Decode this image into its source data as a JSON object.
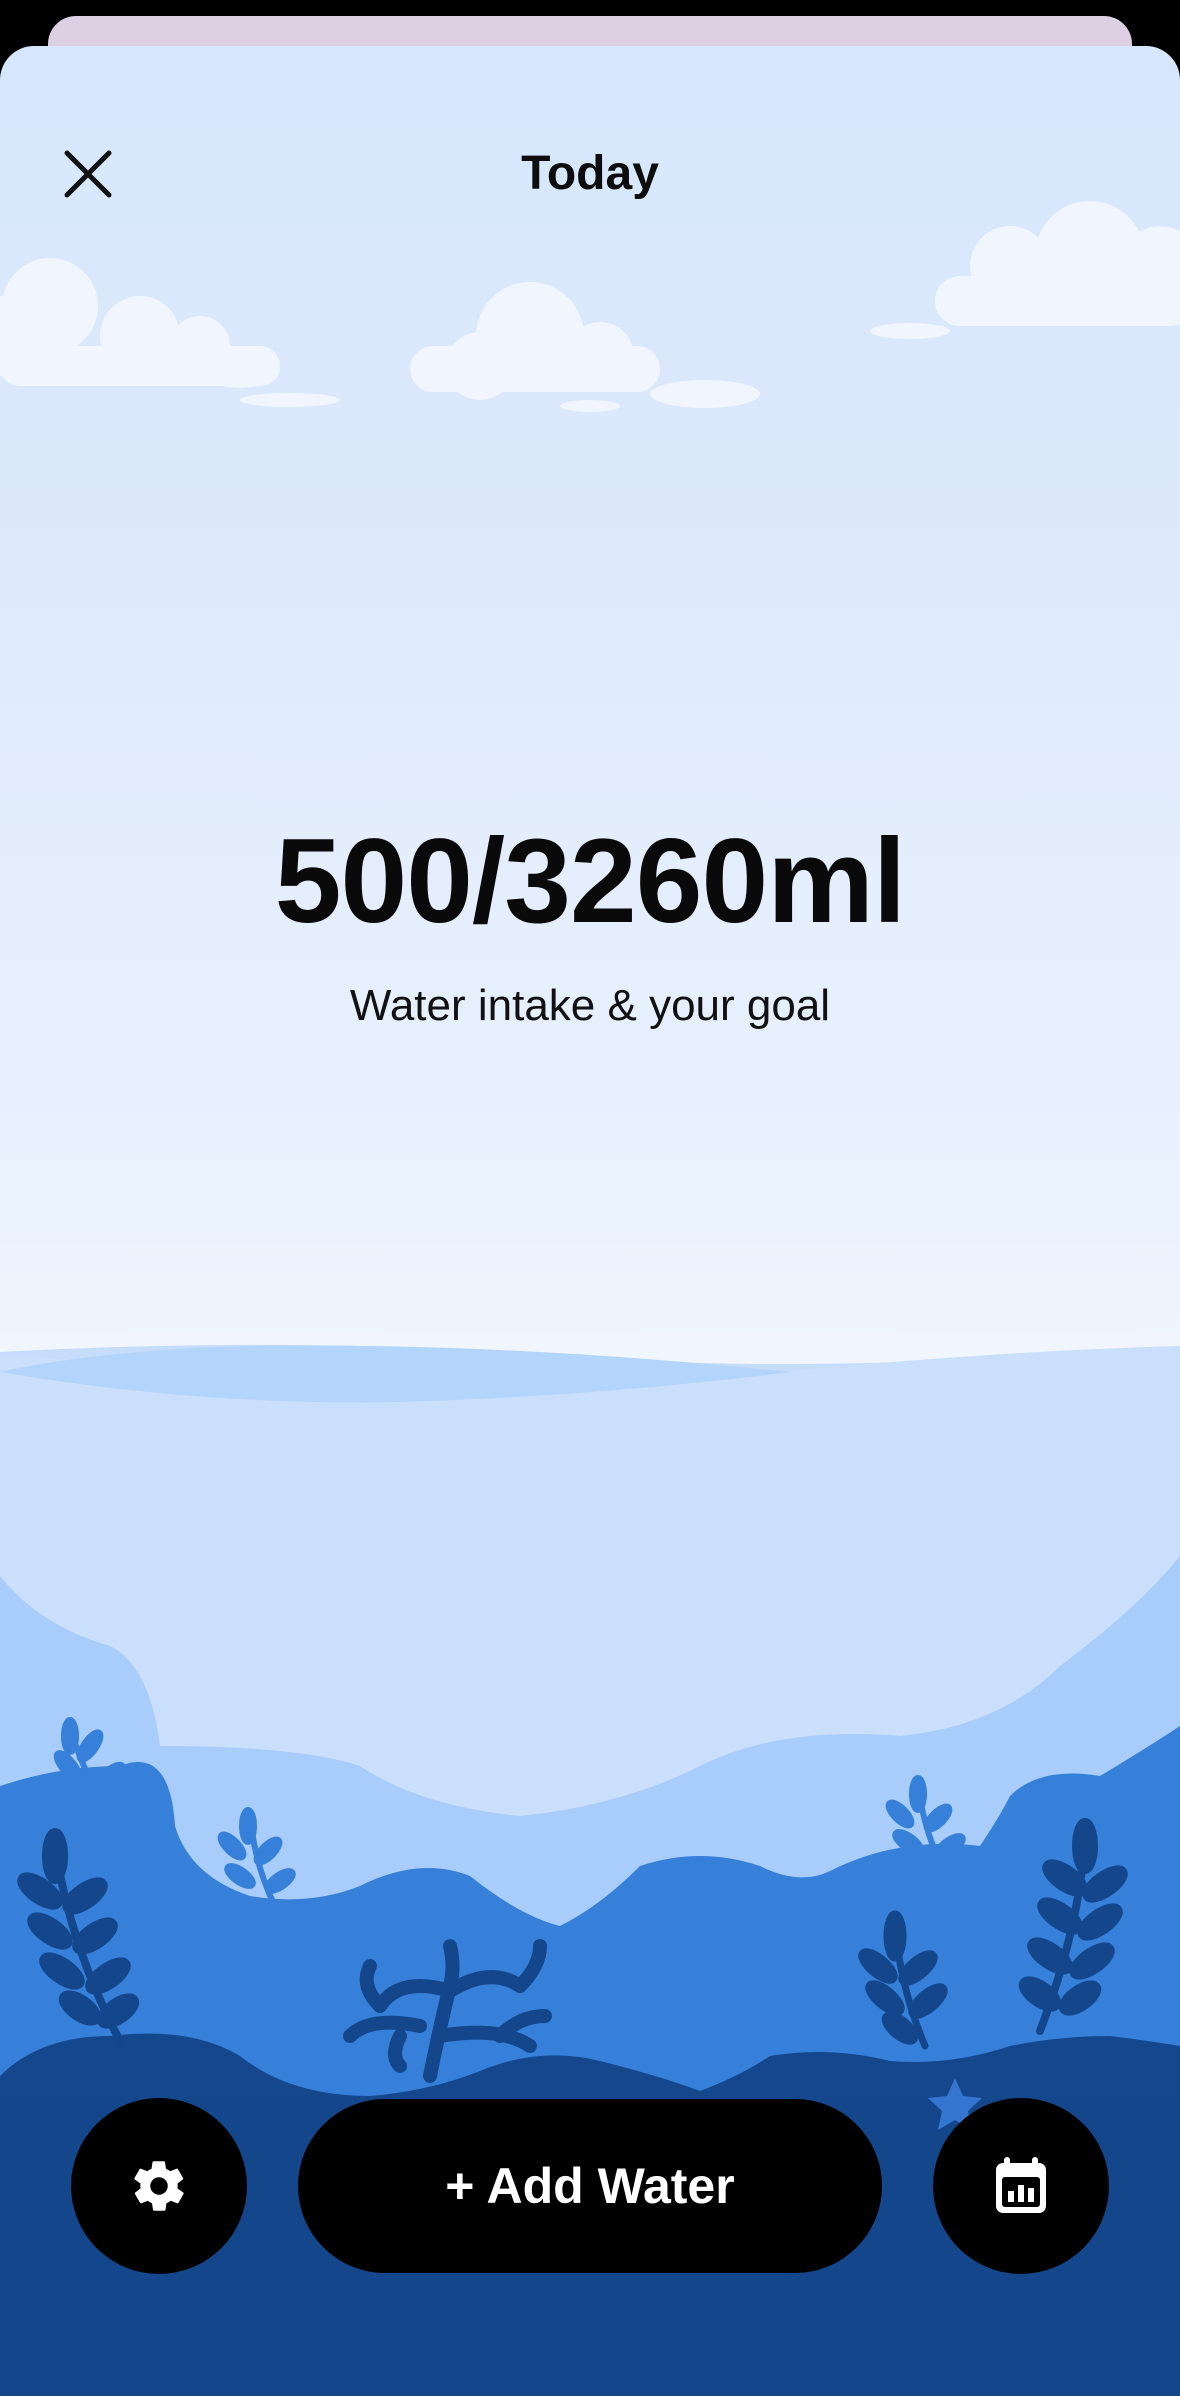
{
  "header": {
    "title": "Today",
    "close_icon": "close-icon"
  },
  "intake": {
    "value_text": "500/3260ml",
    "current_ml": 500,
    "goal_ml": 3260,
    "caption": "Water intake & your goal"
  },
  "actions": {
    "settings_icon": "gear-icon",
    "add_label": "+ Add Water",
    "stats_icon": "calendar-chart-icon"
  },
  "colors": {
    "sky_top": "#d6e7fd",
    "water_light": "#c9dffb",
    "water_mid": "#a8cdfa",
    "water_blue": "#347fd8",
    "water_deep": "#14468c",
    "button": "#000000"
  }
}
